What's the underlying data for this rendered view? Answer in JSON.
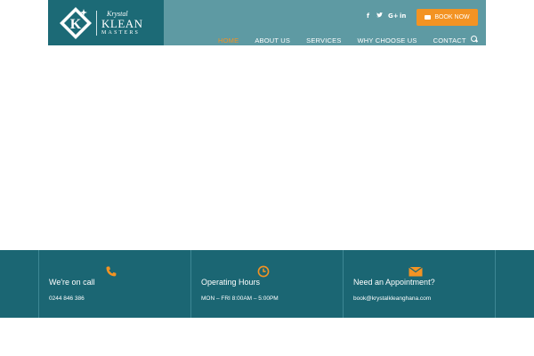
{
  "colors": {
    "header_bg": "#5e9aa3",
    "logo_bg": "#1c6a76",
    "accent": "#f39323",
    "band_bg": "#1b6673"
  },
  "logo": {
    "line1": "Krystal",
    "line2": "KLEAN",
    "line3": "MASTERS",
    "icon": "diamond-k-logo-icon"
  },
  "social": [
    {
      "name": "facebook-icon",
      "glyph": "f"
    },
    {
      "name": "twitter-icon",
      "glyph": "🐦"
    },
    {
      "name": "google-plus-icon",
      "glyph": "G+"
    },
    {
      "name": "linkedin-icon",
      "glyph": "in"
    }
  ],
  "book_button": {
    "label": "BOOK NOW",
    "icon": "folder-icon"
  },
  "nav": {
    "items": [
      {
        "label": "HOME",
        "active": true
      },
      {
        "label": "ABOUT US",
        "active": false
      },
      {
        "label": "SERVICES",
        "active": false
      },
      {
        "label": "WHY CHOOSE US",
        "active": false
      },
      {
        "label": "CONTACT",
        "active": false
      }
    ],
    "search_icon": "search-icon"
  },
  "info": [
    {
      "icon": "phone-icon",
      "title": "We're on call",
      "value": "0244 846 386"
    },
    {
      "icon": "clock-icon",
      "title": "Operating Hours",
      "value": "MON – FRI 8:00AM – 5:00PM"
    },
    {
      "icon": "envelope-icon",
      "title": "Need an Appointment?",
      "value": "book@krystalkleanghana.com"
    }
  ]
}
